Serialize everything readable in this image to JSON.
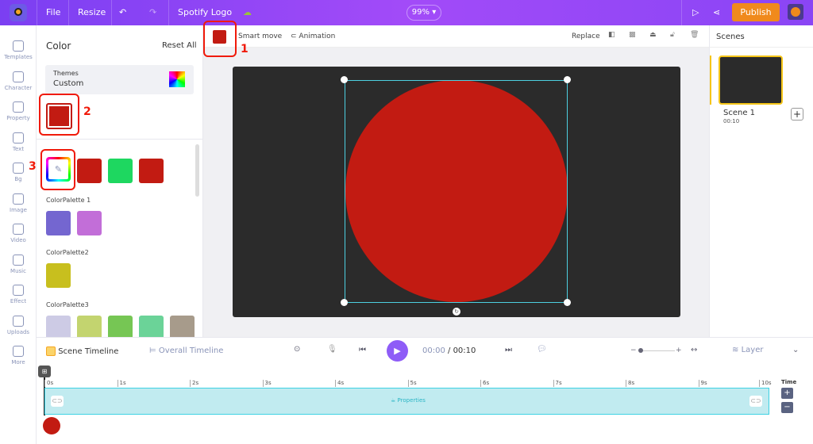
{
  "topbar": {
    "file": "File",
    "resize": "Resize",
    "title": "Spotify Logo",
    "zoom": "99%",
    "publish": "Publish"
  },
  "nav": [
    {
      "label": "Templates"
    },
    {
      "label": "Character"
    },
    {
      "label": "Property"
    },
    {
      "label": "Text"
    },
    {
      "label": "Bg"
    },
    {
      "label": "Image"
    },
    {
      "label": "Video"
    },
    {
      "label": "Music"
    },
    {
      "label": "Effect"
    },
    {
      "label": "Uploads"
    },
    {
      "label": "More"
    }
  ],
  "panel": {
    "title": "Color",
    "reset": "Reset All",
    "themes_label": "Themes",
    "themes_value": "Custom",
    "current_color": "#c21b12",
    "recent": [
      "#c21b12",
      "#1ed760",
      "#c21b12"
    ],
    "palettes": [
      {
        "name": "ColorPalette 1",
        "colors": [
          "#7466d0",
          "#c26ed8"
        ]
      },
      {
        "name": "ColorPalette2",
        "colors": [
          "#c8bf1e"
        ]
      },
      {
        "name": "ColorPalette3",
        "colors": [
          "#cdcbe5",
          "#c3d46f",
          "#76c654",
          "#6bd398",
          "#a79b8b"
        ]
      }
    ]
  },
  "annotations": [
    "1",
    "2",
    "3"
  ],
  "toolbar": {
    "smart_move": "Smart move",
    "animation": "Animation",
    "replace": "Replace",
    "fill": "#c21b12"
  },
  "scenes": {
    "title": "Scenes",
    "scene_name": "Scene 1",
    "scene_time": "00:10"
  },
  "timeline": {
    "scene_tab": "Scene Timeline",
    "overall_tab": "Overall Timeline",
    "current": "00:00",
    "total": "00:10",
    "layer": "Layer",
    "time_label": "Time",
    "properties": "Properties",
    "ticks": [
      "0s",
      "1s",
      "2s",
      "3s",
      "4s",
      "5s",
      "6s",
      "7s",
      "8s",
      "9s",
      "10s"
    ]
  }
}
